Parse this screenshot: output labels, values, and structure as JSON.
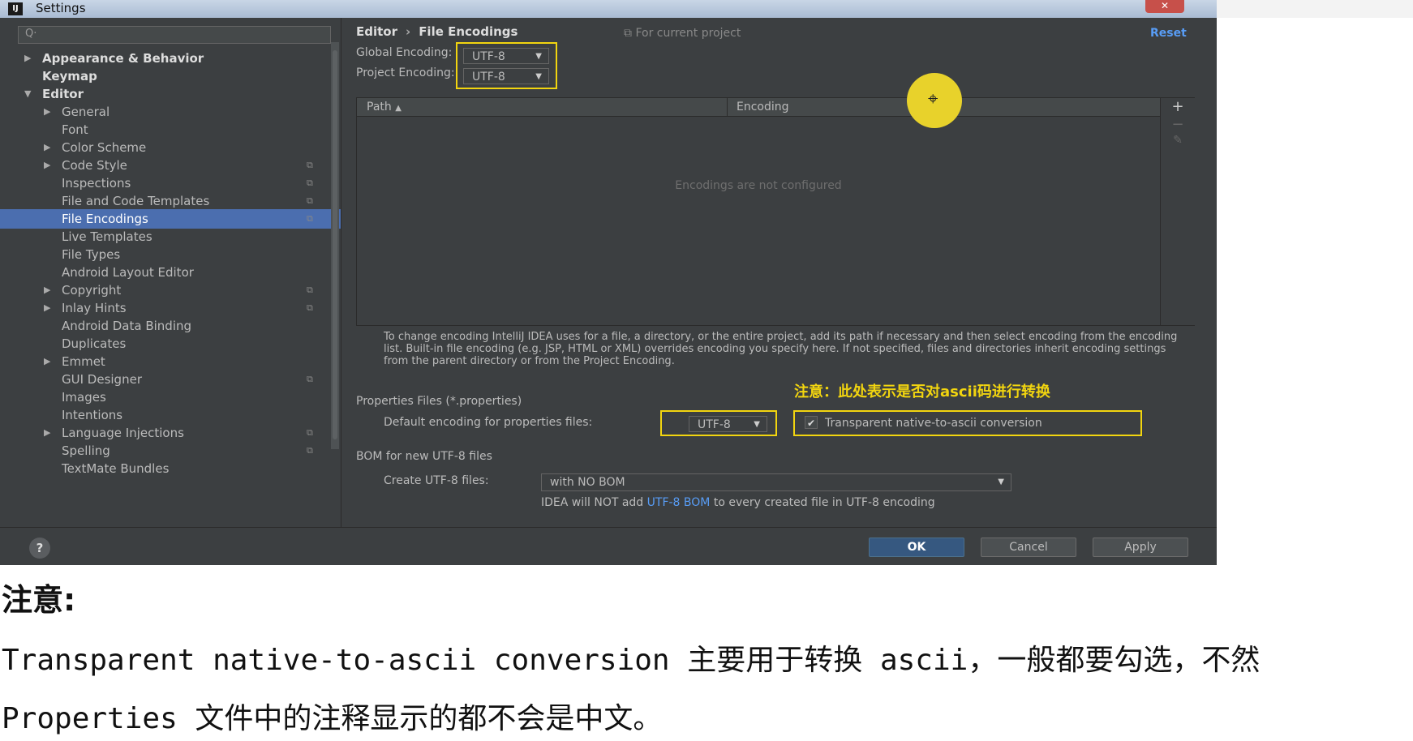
{
  "window": {
    "title": "Settings",
    "app_icon": "intellij-icon",
    "close_label": "✕"
  },
  "sidebar": {
    "search_placeholder": "",
    "items": [
      {
        "label": "Appearance & Behavior",
        "arrow": "▶"
      },
      {
        "label": "Keymap"
      },
      {
        "label": "Editor",
        "arrow": "▼"
      },
      {
        "label": "General",
        "arrow": "▶"
      },
      {
        "label": "Font"
      },
      {
        "label": "Color Scheme",
        "arrow": "▶"
      },
      {
        "label": "Code Style",
        "arrow": "▶"
      },
      {
        "label": "Inspections"
      },
      {
        "label": "File and Code Templates"
      },
      {
        "label": "File Encodings"
      },
      {
        "label": "Live Templates"
      },
      {
        "label": "File Types"
      },
      {
        "label": "Android Layout Editor"
      },
      {
        "label": "Copyright",
        "arrow": "▶"
      },
      {
        "label": "Inlay Hints",
        "arrow": "▶"
      },
      {
        "label": "Android Data Binding"
      },
      {
        "label": "Duplicates"
      },
      {
        "label": "Emmet",
        "arrow": "▶"
      },
      {
        "label": "GUI Designer"
      },
      {
        "label": "Images"
      },
      {
        "label": "Intentions"
      },
      {
        "label": "Language Injections",
        "arrow": "▶"
      },
      {
        "label": "Spelling"
      },
      {
        "label": "TextMate Bundles"
      }
    ]
  },
  "main": {
    "breadcrumb": [
      "Editor",
      "File Encodings"
    ],
    "breadcrumb_sep": "›",
    "for_project": "For current project",
    "reset": "Reset",
    "global_encoding_label": "Global Encoding:",
    "global_encoding_value": "UTF-8",
    "project_encoding_label": "Project Encoding:",
    "project_encoding_value": "UTF-8",
    "table": {
      "col_path": "Path",
      "col_encoding": "Encoding",
      "empty": "Encodings are not configured",
      "add": "+",
      "remove": "−",
      "edit": "✎"
    },
    "help_text": "To change encoding IntelliJ IDEA uses for a file, a directory, or the entire project, add its path if necessary and then select encoding from the encoding list. Built-in file encoding (e.g. JSP, HTML or XML) overrides encoding you specify here. If not specified, files and directories inherit encoding settings from the parent directory or from the Project Encoding.",
    "properties_section": "Properties Files (*.properties)",
    "default_props_label": "Default encoding for properties files:",
    "default_props_value": "UTF-8",
    "annotation_cn": "注意：此处表示是否对ascii码进行转换",
    "native_ascii_label": "Transparent native-to-ascii conversion",
    "native_ascii_checked": true,
    "bom_section": "BOM for new UTF-8 files",
    "create_utf8_label": "Create UTF-8 files:",
    "create_utf8_value": "with NO BOM",
    "bom_info_pre": "IDEA will NOT add",
    "bom_info_link": "UTF-8 BOM",
    "bom_info_post": "to every created file in UTF-8 encoding"
  },
  "footer": {
    "help": "?",
    "ok": "OK",
    "cancel": "Cancel",
    "apply": "Apply"
  },
  "article": {
    "heading": "注意:",
    "line1": "Transparent native-to-ascii conversion 主要用于转换 ascii，一般都要勾选，不然",
    "line2": "Properties 文件中的注释显示的都不会是中文。"
  },
  "colors": {
    "highlight": "#f2d50f",
    "accent": "#4b6eaf",
    "link": "#589df6"
  }
}
